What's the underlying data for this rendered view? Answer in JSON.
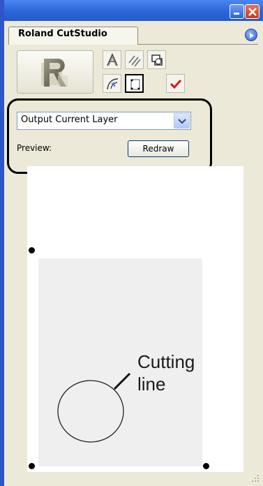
{
  "window": {
    "minimize_icon": "minimize-icon",
    "close_icon": "close-icon"
  },
  "panel": {
    "tab_label": "Roland CutStudio",
    "menu_icon": "panel-menu-icon"
  },
  "tools": [
    {
      "name": "outline-font-icon",
      "selected": false
    },
    {
      "name": "hatch-icon",
      "selected": false
    },
    {
      "name": "weld-shapes-icon",
      "selected": false
    },
    {
      "name": "curve-icon",
      "selected": false
    },
    {
      "name": "crop-marks-icon",
      "selected": true
    },
    {
      "name": "checkmark-icon",
      "selected": false
    }
  ],
  "output": {
    "selected": "Output Current Layer"
  },
  "preview": {
    "label": "Preview:",
    "redraw_label": "Redraw"
  },
  "annotation": {
    "line1": "Cutting",
    "line2": "line"
  },
  "colors": {
    "titlebar": "#2b66d9",
    "panel_bg": "#ece9d8",
    "checkmark": "#e0141e"
  }
}
